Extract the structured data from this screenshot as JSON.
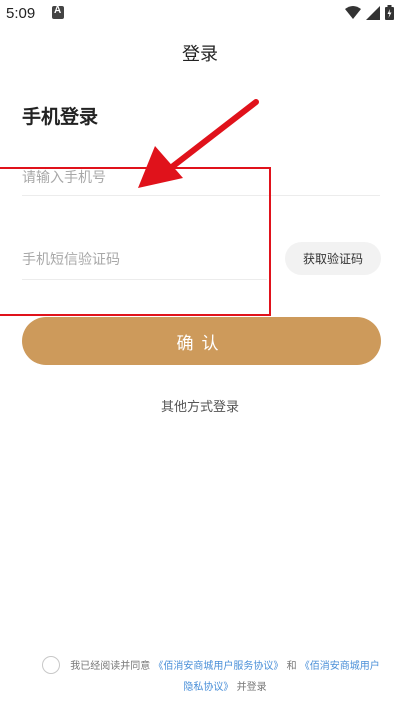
{
  "status_bar": {
    "time": "5:09",
    "icons": [
      "notification-a-icon",
      "wifi-icon",
      "signal-icon",
      "battery-icon"
    ]
  },
  "nav": {
    "title": "登录"
  },
  "form": {
    "heading": "手机登录",
    "phone_placeholder": "请输入手机号",
    "code_placeholder": "手机短信验证码",
    "get_code_label": "获取验证码",
    "confirm_label": "确认"
  },
  "other_login": "其他方式登录",
  "agreement": {
    "prefix": "我已经阅读并同意",
    "user_agreement": "《佰消安商城用户服务协议》",
    "and": "和",
    "privacy_policy": "《佰消安商城用户隐私协议》",
    "suffix": "并登录"
  },
  "colors": {
    "accent": "#cd9a5b",
    "annotation": "#e0121b",
    "link": "#4a8fd8"
  }
}
